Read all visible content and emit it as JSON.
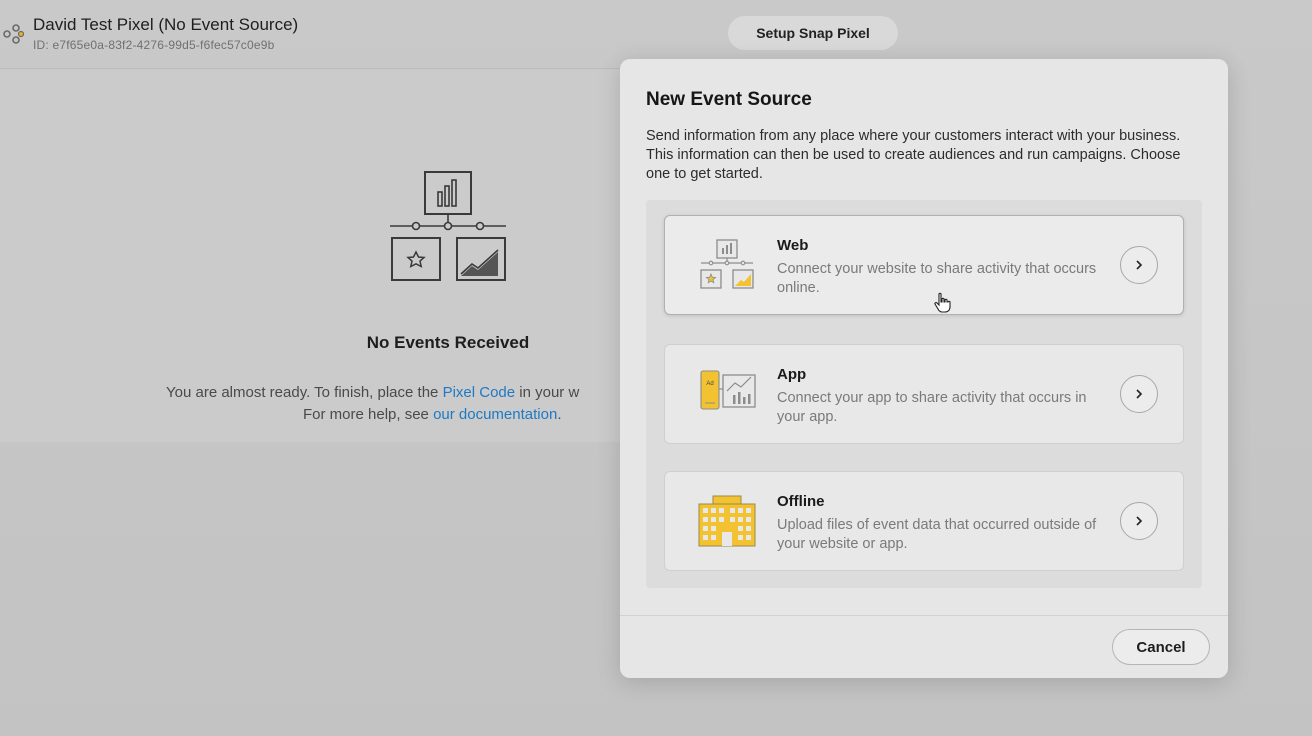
{
  "header": {
    "pixel_name": "David Test Pixel (No Event Source)",
    "pixel_id": "ID: e7f65e0a-83f2-4276-99d5-f6fec57c0e9b",
    "setup_button": "Setup Snap Pixel"
  },
  "events_panel": {
    "title": "No Events Received",
    "help_prefix": "You are almost ready. To finish, place the ",
    "pixel_code_link": "Pixel Code",
    "help_suffix": " in your w",
    "more_help_prefix": "For more help, see ",
    "documentation_link": "our documentation",
    "more_help_suffix": "."
  },
  "modal": {
    "title": "New Event Source",
    "description": "Send information from any place where your customers interact with your business. This information can then be used to create audiences and run campaigns. Choose one to get started.",
    "options": [
      {
        "title": "Web",
        "description": "Connect your website to share activity that occurs online.",
        "icon": "web-pixel-icon",
        "selected": true
      },
      {
        "title": "App",
        "description": "Connect your app to share activity that occurs in your app.",
        "icon": "app-ad-icon",
        "selected": false
      },
      {
        "title": "Offline",
        "description": "Upload files of event data that occurred outside of your website or app.",
        "icon": "building-icon",
        "selected": false
      }
    ],
    "cancel_button": "Cancel"
  },
  "colors": {
    "accent_yellow": "#f2c230",
    "link_blue": "#1f79c4",
    "icon_gray": "#8c8c8c"
  }
}
